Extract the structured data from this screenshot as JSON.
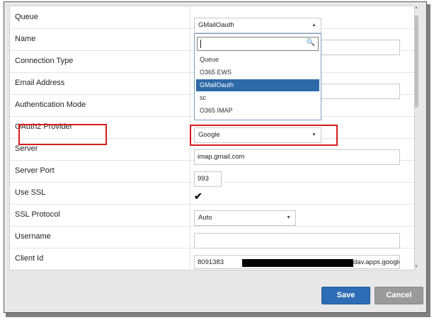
{
  "fields": {
    "queue": {
      "label": "Queue",
      "value": "GMailOauth"
    },
    "name": {
      "label": "Name"
    },
    "connection_type": {
      "label": "Connection Type"
    },
    "email_address": {
      "label": "Email Address"
    },
    "auth_mode": {
      "label": "Authentication Mode"
    },
    "oauth2_provider": {
      "label": "OAuth2 Provider",
      "value": "Google"
    },
    "server": {
      "label": "Server",
      "value": "imap.gmail.com"
    },
    "server_port": {
      "label": "Server Port",
      "value": "993"
    },
    "use_ssl": {
      "label": "Use SSL",
      "checked": true
    },
    "ssl_protocol": {
      "label": "SSL Protocol",
      "value": "Auto"
    },
    "username": {
      "label": "Username",
      "value": ""
    },
    "client_id": {
      "label": "Client Id",
      "value_start": "8091383",
      "value_end": "dav.apps.google"
    }
  },
  "queue_dropdown": {
    "search_value": "",
    "options": [
      "Queue",
      "O365 EWS",
      "GMailOauth",
      "sc",
      "O365 IMAP"
    ],
    "selected": "GMailOauth"
  },
  "buttons": {
    "save": "Save",
    "cancel": "Cancel"
  },
  "colors": {
    "save": "#2d6db5",
    "cancel": "#9a9a9a",
    "highlight": "#d81b1b",
    "selected_option": "#2e6aa7"
  }
}
